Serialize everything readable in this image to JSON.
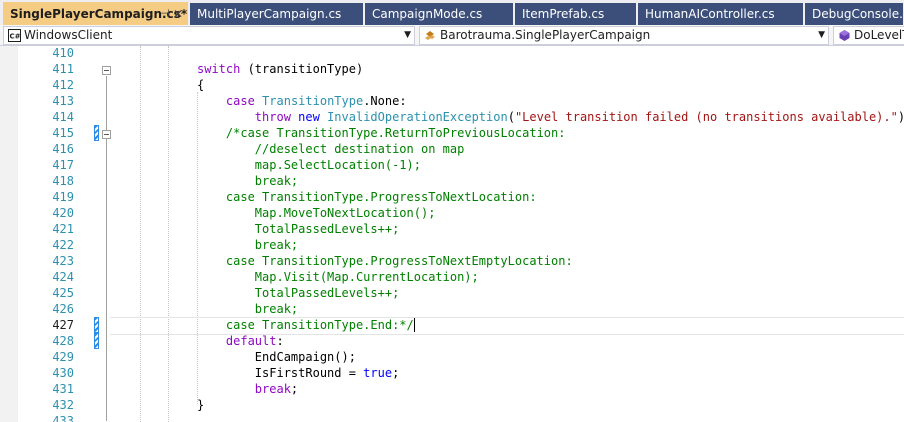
{
  "tabs": [
    {
      "label": "SinglePlayerCampaign.cs*",
      "active": true,
      "pin_glyph": "⊣",
      "close_glyph": "✕"
    },
    {
      "label": "MultiPlayerCampaign.cs"
    },
    {
      "label": "CampaignMode.cs"
    },
    {
      "label": "ItemPrefab.cs"
    },
    {
      "label": "HumanAIController.cs"
    },
    {
      "label": "DebugConsole.cs"
    }
  ],
  "navbar": {
    "project": {
      "label": "WindowsClient",
      "icon": "csharp-project-icon"
    },
    "type": {
      "label": "Barotrauma.SinglePlayerCampaign",
      "icon": "class-icon"
    },
    "member": {
      "label": "DoLevelTr",
      "icon": "method-icon"
    }
  },
  "editor": {
    "current_line": "427",
    "lines": [
      {
        "num": "410",
        "segs": []
      },
      {
        "num": "411",
        "segs": [
          {
            "t": "switch",
            "c": "ctl"
          },
          {
            "t": " (transitionType)"
          }
        ]
      },
      {
        "num": "412",
        "segs": [
          {
            "t": "{"
          }
        ]
      },
      {
        "num": "413",
        "segs": [
          {
            "t": "    "
          },
          {
            "t": "case",
            "c": "ctl"
          },
          {
            "t": " "
          },
          {
            "t": "TransitionType",
            "c": "ty"
          },
          {
            "t": ".None:"
          }
        ]
      },
      {
        "num": "414",
        "segs": [
          {
            "t": "        "
          },
          {
            "t": "throw",
            "c": "ctl"
          },
          {
            "t": " "
          },
          {
            "t": "new",
            "c": "kw"
          },
          {
            "t": " "
          },
          {
            "t": "InvalidOperationException",
            "c": "ty"
          },
          {
            "t": "("
          },
          {
            "t": "\"Level transition failed (no transitions available).\"",
            "c": "str"
          },
          {
            "t": ");"
          }
        ]
      },
      {
        "num": "415",
        "segs": [
          {
            "t": "    "
          },
          {
            "t": "/*case TransitionType.ReturnToPreviousLocation:",
            "c": "cm"
          }
        ]
      },
      {
        "num": "416",
        "segs": [
          {
            "t": "        //deselect destination on map",
            "c": "cm"
          }
        ]
      },
      {
        "num": "417",
        "segs": [
          {
            "t": "        map.SelectLocation(-1);",
            "c": "cm"
          }
        ]
      },
      {
        "num": "418",
        "segs": [
          {
            "t": "        break;",
            "c": "cm"
          }
        ]
      },
      {
        "num": "419",
        "segs": [
          {
            "t": "    case TransitionType.ProgressToNextLocation:",
            "c": "cm"
          }
        ]
      },
      {
        "num": "420",
        "segs": [
          {
            "t": "        Map.MoveToNextLocation();",
            "c": "cm"
          }
        ]
      },
      {
        "num": "421",
        "segs": [
          {
            "t": "        TotalPassedLevels++;",
            "c": "cm"
          }
        ]
      },
      {
        "num": "422",
        "segs": [
          {
            "t": "        break;",
            "c": "cm"
          }
        ]
      },
      {
        "num": "423",
        "segs": [
          {
            "t": "    case TransitionType.ProgressToNextEmptyLocation:",
            "c": "cm"
          }
        ]
      },
      {
        "num": "424",
        "segs": [
          {
            "t": "        Map.Visit(Map.CurrentLocation);",
            "c": "cm"
          }
        ]
      },
      {
        "num": "425",
        "segs": [
          {
            "t": "        TotalPassedLevels++;",
            "c": "cm"
          }
        ]
      },
      {
        "num": "426",
        "segs": [
          {
            "t": "        break;",
            "c": "cm"
          }
        ]
      },
      {
        "num": "427",
        "segs": [
          {
            "t": "    case TransitionType.End:*/",
            "c": "cm"
          }
        ]
      },
      {
        "num": "428",
        "segs": [
          {
            "t": "    "
          },
          {
            "t": "default",
            "c": "ctl"
          },
          {
            "t": ":"
          }
        ]
      },
      {
        "num": "429",
        "segs": [
          {
            "t": "        EndCampaign();"
          }
        ]
      },
      {
        "num": "430",
        "segs": [
          {
            "t": "        IsFirstRound = "
          },
          {
            "t": "true",
            "c": "kw"
          },
          {
            "t": ";"
          }
        ]
      },
      {
        "num": "431",
        "segs": [
          {
            "t": "        "
          },
          {
            "t": "break",
            "c": "ctl"
          },
          {
            "t": ";"
          }
        ]
      },
      {
        "num": "432",
        "segs": [
          {
            "t": "}"
          }
        ]
      },
      {
        "num": "433",
        "segs": []
      }
    ]
  }
}
